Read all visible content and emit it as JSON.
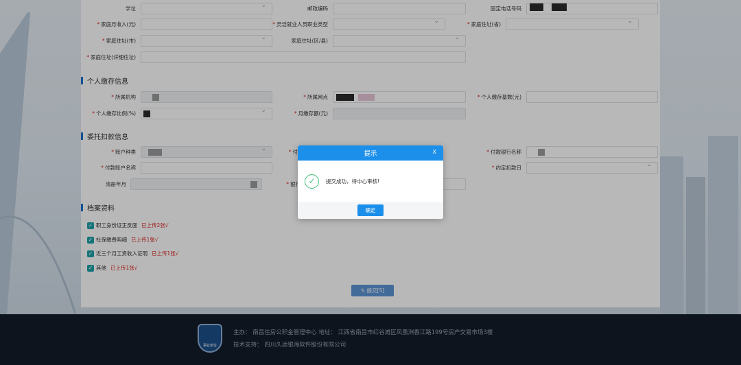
{
  "form": {
    "fields": {
      "xuewei": {
        "label": "学位",
        "required": false
      },
      "youzheng": {
        "label": "邮政编码",
        "required": false
      },
      "guding_dianhua": {
        "label": "固定电话号码",
        "required": false
      },
      "jiating_shouru": {
        "label": "家庭月收入(元)",
        "required": true
      },
      "linghuo_leixing": {
        "label": "灵活就业人员职业类型",
        "required": true
      },
      "zhuzhi_sheng": {
        "label": "家庭住址(省)",
        "required": true
      },
      "zhuzhi_shi": {
        "label": "家庭住址(市)",
        "required": true
      },
      "zhuzhi_qu": {
        "label": "家庭住址(区/县)",
        "required": false
      },
      "zhuzhi_xiangxi": {
        "label": "家庭住址(详细住址)",
        "required": true
      },
      "suoshu_jigou": {
        "label": "所属机构",
        "required": true
      },
      "suoshu_wangdian": {
        "label": "所属网点",
        "required": true
      },
      "jiaocun_jishu": {
        "label": "个人缴存基数(元)",
        "required": true
      },
      "jiaocun_bili": {
        "label": "个人缴存比例(%)",
        "required": true
      },
      "yue_jiaocun": {
        "label": "月缴存额(元)",
        "required": true
      },
      "zhanghu_zhonglei": {
        "label": "账户种类",
        "required": true
      },
      "fukuan_yinhang_mingcheng": {
        "label": "付款银行名称",
        "required": true
      },
      "fukuan_zhanghu_mingcheng": {
        "label": "付款账户名称",
        "required": true
      },
      "yueding_kouqian": {
        "label": "约定扣款日",
        "required": true
      },
      "qingce_nianyue": {
        "label": "清册年月",
        "required": false
      }
    },
    "partial_labels": {
      "fu": "付",
      "yinhang": "银行"
    }
  },
  "sections": {
    "personal_deposit": "个人缴存信息",
    "entrust_debit": "委托扣款信息",
    "archives": "档案资料"
  },
  "archives": [
    {
      "label": "职工身份证正反面",
      "status": "已上传2张√",
      "checked": true
    },
    {
      "label": "社保缴费明细",
      "status": "已上传1张√",
      "checked": true
    },
    {
      "label": "近三个月工资收入证明",
      "status": "已上传1张√",
      "checked": true
    },
    {
      "label": "其他",
      "status": "已上传1张√",
      "checked": true
    }
  ],
  "submit_label": "提交[S]",
  "dialog": {
    "title": "提示",
    "close": "X",
    "message": "提交成功，待中心审核!",
    "ok": "确定"
  },
  "footer": {
    "logo_text": "事业单位",
    "line1": "主办： 南昌住房公积金管理中心    地址： 江西省南昌市红谷滩区凤凰洲香江路199号房产交易市场3楼",
    "line2": "技术支持： 四川久远银海软件股份有限公司"
  },
  "colors": {
    "primary": "#1c8fea",
    "required": "#e02020",
    "success": "#3fbf7a",
    "footer": "#141c2a"
  }
}
